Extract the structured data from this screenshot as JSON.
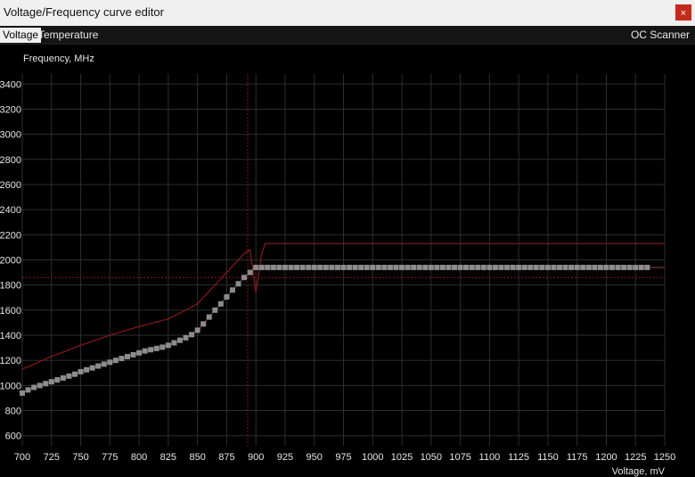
{
  "window": {
    "title": "Voltage/Frequency curve editor",
    "close_label": "×"
  },
  "tabs": [
    {
      "label": "Voltage",
      "active": true
    },
    {
      "label": "Temperature",
      "active": false
    }
  ],
  "oc_scanner_label": "OC Scanner",
  "colors": {
    "curve_point": "#8c8c8c",
    "curve_line": "#8b1a1a",
    "background": "#000000",
    "grid": "#2e2e2e"
  },
  "chart_data": {
    "type": "line",
    "ylabel": "Frequency, MHz",
    "xlabel": "Voltage, mV",
    "xlim": [
      700,
      1250
    ],
    "ylim": [
      520,
      3480
    ],
    "grid": true,
    "x_ticks": [
      700,
      725,
      750,
      775,
      800,
      825,
      850,
      875,
      900,
      925,
      950,
      975,
      1000,
      1025,
      1050,
      1075,
      1100,
      1125,
      1150,
      1175,
      1200,
      1225,
      1250
    ],
    "y_ticks": [
      600,
      800,
      1000,
      1200,
      1400,
      1600,
      1800,
      2000,
      2200,
      2400,
      2600,
      2800,
      3000,
      3200,
      3400
    ],
    "y_tick_labels": [
      "600",
      "800",
      "1000",
      "1200",
      "1400",
      "1600",
      "1800",
      "2000",
      "2200",
      "2400",
      "2600",
      "2800",
      "3000",
      "3200",
      "3400"
    ],
    "selected_voltage": 893,
    "max_frequency_guide": 1860,
    "series": [
      {
        "x": [
          700,
          725,
          750,
          775,
          800,
          825,
          840,
          850,
          860,
          870,
          880,
          890,
          895,
          900,
          905,
          908,
          1250
        ],
        "y": [
          1130,
          1230,
          1320,
          1400,
          1470,
          1530,
          1600,
          1650,
          1750,
          1850,
          1950,
          2050,
          2080,
          1740,
          2050,
          2130,
          2130
        ]
      },
      {
        "x": [
          700,
          705,
          710,
          715,
          720,
          725,
          730,
          735,
          740,
          745,
          750,
          755,
          760,
          765,
          770,
          775,
          780,
          785,
          790,
          795,
          800,
          805,
          810,
          815,
          820,
          825,
          830,
          835,
          840,
          845,
          850,
          855,
          860,
          865,
          870,
          875,
          880,
          885,
          890,
          895
        ],
        "y": [
          940,
          965,
          985,
          1000,
          1015,
          1030,
          1045,
          1060,
          1075,
          1090,
          1110,
          1125,
          1140,
          1155,
          1170,
          1185,
          1200,
          1215,
          1230,
          1245,
          1260,
          1275,
          1285,
          1295,
          1305,
          1320,
          1340,
          1360,
          1380,
          1405,
          1440,
          1490,
          1545,
          1600,
          1650,
          1705,
          1760,
          1810,
          1860,
          1900
        ],
        "flat_from": 900,
        "flat_to": 1235,
        "flat_value": 1940
      }
    ]
  }
}
